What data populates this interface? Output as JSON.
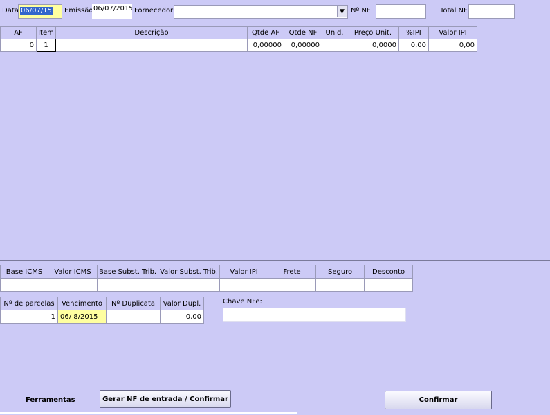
{
  "header": {
    "data_label": "Data",
    "data_value": "06/07/15",
    "emissao_label": "Emissão",
    "emissao_value": "06/07/2015",
    "fornecedor_label": "Fornecedor",
    "fornecedor_value": "",
    "nf_label": "Nº NF",
    "nf_value": "",
    "total_nf_label": "Total NF",
    "total_nf_value": ""
  },
  "items_table": {
    "columns": [
      "AF",
      "Item",
      "Descrição",
      "Qtde AF",
      "Qtde NF",
      "Unid.",
      "Preço Unit.",
      "%IPI",
      "Valor IPI"
    ],
    "rows": [
      [
        "0",
        "1",
        "",
        "0,00000",
        "0,00000",
        "",
        "0,0000",
        "0,00",
        "0,00"
      ]
    ]
  },
  "totals_table": {
    "columns": [
      "Base ICMS",
      "Valor ICMS",
      "Base Subst. Trib.",
      "Valor Subst. Trib.",
      "Valor IPI",
      "Frete",
      "Seguro",
      "Desconto"
    ],
    "values": [
      "",
      "",
      "",
      "",
      "",
      "",
      "",
      ""
    ]
  },
  "parcels_table": {
    "columns": [
      "Nº de parcelas",
      "Vencimento",
      "Nº Duplicata",
      "Valor Dupl."
    ],
    "rows": [
      [
        "1",
        "06/ 8/2015",
        "",
        "0,00"
      ]
    ]
  },
  "chave_nfe": {
    "label": "Chave NFe:",
    "value": ""
  },
  "footer": {
    "ferramentas_label": "Ferramentas",
    "gerar_button": "Gerar NF de entrada / Confirmar",
    "confirmar_button": "Confirmar"
  },
  "colors": {
    "background": "#cccaf6",
    "selection": "#3366cc",
    "highlight": "#ffffa0"
  }
}
